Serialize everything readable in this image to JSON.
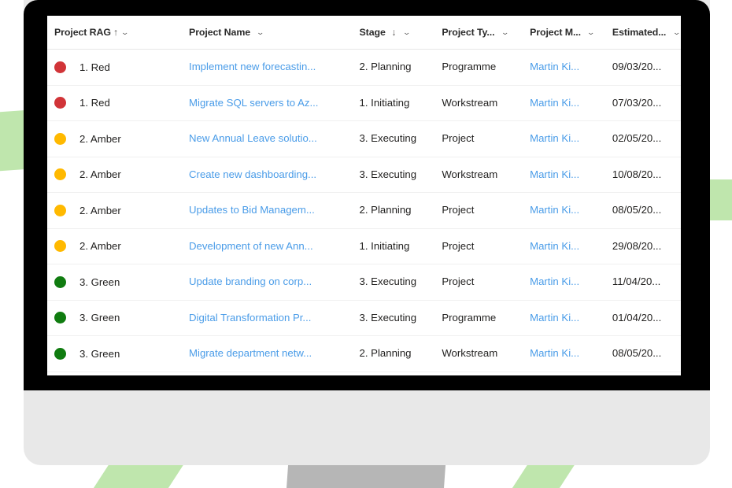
{
  "grid": {
    "columns": [
      {
        "label": "Project RAG",
        "sort": "↑",
        "chevron": "⌄",
        "key": "rag"
      },
      {
        "label": "Project Name",
        "sort": "",
        "chevron": "⌄",
        "key": "name"
      },
      {
        "label": "Stage",
        "sort": "↓",
        "chevron": "⌄",
        "key": "stage"
      },
      {
        "label": "Project Ty...",
        "sort": "",
        "chevron": "⌄",
        "key": "type"
      },
      {
        "label": "Project M...",
        "sort": "",
        "chevron": "⌄",
        "key": "manager"
      },
      {
        "label": "Estimated...",
        "sort": "",
        "chevron": "⌄",
        "key": "date"
      }
    ],
    "rows": [
      {
        "rag": "1. Red",
        "rag_color": "#d13438",
        "name": "Implement new forecastin...",
        "stage": "2. Planning",
        "type": "Programme",
        "manager": "Martin Ki...",
        "date": "09/03/20..."
      },
      {
        "rag": "1. Red",
        "rag_color": "#d13438",
        "name": "Migrate SQL servers to Az...",
        "stage": "1. Initiating",
        "type": "Workstream",
        "manager": "Martin Ki...",
        "date": "07/03/20..."
      },
      {
        "rag": "2. Amber",
        "rag_color": "#ffb900",
        "name": "New Annual Leave solutio...",
        "stage": "3. Executing",
        "type": "Project",
        "manager": "Martin Ki...",
        "date": "02/05/20..."
      },
      {
        "rag": "2. Amber",
        "rag_color": "#ffb900",
        "name": "Create new dashboarding...",
        "stage": "3. Executing",
        "type": "Workstream",
        "manager": "Martin Ki...",
        "date": "10/08/20..."
      },
      {
        "rag": "2. Amber",
        "rag_color": "#ffb900",
        "name": "Updates to Bid Managem...",
        "stage": "2. Planning",
        "type": "Project",
        "manager": "Martin Ki...",
        "date": "08/05/20..."
      },
      {
        "rag": "2. Amber",
        "rag_color": "#ffb900",
        "name": "Development of new Ann...",
        "stage": "1. Initiating",
        "type": "Project",
        "manager": "Martin Ki...",
        "date": "29/08/20..."
      },
      {
        "rag": "3. Green",
        "rag_color": "#107c10",
        "name": "Update branding on corp...",
        "stage": "3. Executing",
        "type": "Project",
        "manager": "Martin Ki...",
        "date": "11/04/20..."
      },
      {
        "rag": "3. Green",
        "rag_color": "#107c10",
        "name": "Digital Transformation Pr...",
        "stage": "3. Executing",
        "type": "Programme",
        "manager": "Martin Ki...",
        "date": "01/04/20..."
      },
      {
        "rag": "3. Green",
        "rag_color": "#107c10",
        "name": "Migrate department netw...",
        "stage": "2. Planning",
        "type": "Workstream",
        "manager": "Martin Ki...",
        "date": "08/05/20..."
      }
    ]
  },
  "theme": {
    "accent_green": "#bfe6ad",
    "link_blue": "#4a9ce8",
    "bezel": "#000000",
    "monitor_body": "#e8e8e8",
    "stand": "#b6b6b6"
  }
}
